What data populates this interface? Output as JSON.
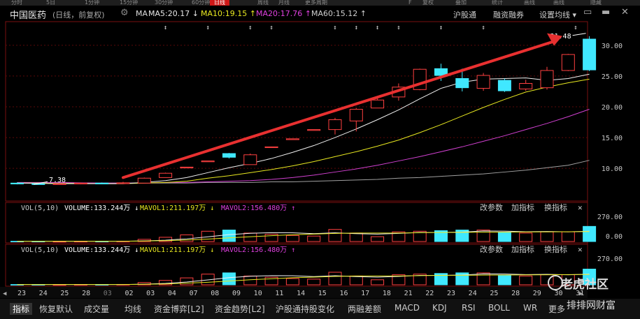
{
  "top_tabs": [
    "分时",
    "5日",
    "1分钟",
    "15分钟",
    "30分钟",
    "60分钟",
    "日线",
    "周线",
    "月线",
    "更多周期",
    "F",
    "复权",
    "叠加",
    "统计",
    "画线",
    "画线",
    "隐藏"
  ],
  "header": {
    "stock_name": "中国医药",
    "mode": "(日线，前复权)",
    "gear_icon": "gear-icon",
    "ma_label": "MA",
    "ma5": "MA5:20.17 ↓",
    "ma10": "MA10:19.15 ↑",
    "ma20": "MA20:17.76 ↑",
    "ma60": "MA60:15.12 ↑",
    "hgt": "沪股通",
    "rzrq": "融资融券",
    "szjx": "设置均线 ▾"
  },
  "chart_data": [
    {
      "type": "candlestick",
      "title": "",
      "ylim": [
        6.5,
        33.5
      ],
      "yticks": [
        "30.00",
        "25.00",
        "20.00",
        "15.00",
        "10.00"
      ],
      "high_label": "31.48",
      "low_label": "7.38",
      "colors": {
        "up": "#ff4040",
        "down": "#40e8ff",
        "ma5": "#f0f0f0",
        "ma10": "#e8e820",
        "ma20": "#d040d0",
        "ma60": "#a0a0a0",
        "arrow": "#e83030"
      },
      "candles": [
        {
          "o": 7.6,
          "c": 7.5,
          "h": 7.7,
          "l": 7.4
        },
        {
          "o": 7.5,
          "c": 7.4,
          "h": 7.6,
          "l": 7.38
        },
        {
          "o": 7.4,
          "c": 7.5,
          "h": 7.6,
          "l": 7.38
        },
        {
          "o": 7.5,
          "c": 7.6,
          "h": 7.7,
          "l": 7.4
        },
        {
          "o": 7.6,
          "c": 7.55,
          "h": 7.7,
          "l": 7.5
        },
        {
          "o": 7.55,
          "c": 7.65,
          "h": 7.8,
          "l": 7.5
        },
        {
          "o": 7.6,
          "c": 8.4,
          "h": 8.5,
          "l": 7.6
        },
        {
          "o": 8.5,
          "c": 9.2,
          "h": 9.3,
          "l": 8.5
        },
        {
          "o": 10.2,
          "c": 10.2,
          "h": 10.2,
          "l": 10.2
        },
        {
          "o": 11.2,
          "c": 11.2,
          "h": 11.2,
          "l": 11.2
        },
        {
          "o": 12.4,
          "c": 11.8,
          "h": 12.5,
          "l": 11.6
        },
        {
          "o": 10.6,
          "c": 12.2,
          "h": 12.4,
          "l": 10.6
        },
        {
          "o": 13.5,
          "c": 13.5,
          "h": 13.5,
          "l": 13.5
        },
        {
          "o": 14.8,
          "c": 14.8,
          "h": 14.8,
          "l": 14.8
        },
        {
          "o": 16.3,
          "c": 16.3,
          "h": 16.3,
          "l": 16.3
        },
        {
          "o": 16.3,
          "c": 17.9,
          "h": 18.2,
          "l": 15.5
        },
        {
          "o": 17.7,
          "c": 19.6,
          "h": 19.8,
          "l": 16.0
        },
        {
          "o": 19.8,
          "c": 21.1,
          "h": 21.4,
          "l": 19.8
        },
        {
          "o": 21.6,
          "c": 23.2,
          "h": 23.8,
          "l": 21.0
        },
        {
          "o": 22.8,
          "c": 26.1,
          "h": 26.2,
          "l": 22.7
        },
        {
          "o": 26.2,
          "c": 25.1,
          "h": 27.0,
          "l": 24.2
        },
        {
          "o": 24.6,
          "c": 23.1,
          "h": 26.2,
          "l": 22.5
        },
        {
          "o": 23.0,
          "c": 25.1,
          "h": 25.5,
          "l": 22.6
        },
        {
          "o": 24.3,
          "c": 22.6,
          "h": 24.6,
          "l": 22.4
        },
        {
          "o": 22.9,
          "c": 23.8,
          "h": 24.4,
          "l": 22.6
        },
        {
          "o": 23.1,
          "c": 25.9,
          "h": 26.5,
          "l": 22.8
        },
        {
          "o": 25.9,
          "c": 28.5,
          "h": 28.6,
          "l": 25.8
        },
        {
          "o": 31.0,
          "c": 26.0,
          "h": 31.48,
          "l": 25.8
        }
      ],
      "ma5": [
        7.6,
        7.55,
        7.5,
        7.5,
        7.5,
        7.5,
        7.7,
        8.0,
        8.5,
        9.3,
        10.1,
        10.8,
        11.6,
        12.6,
        13.7,
        15.0,
        16.4,
        17.9,
        19.5,
        21.3,
        23.0,
        24.0,
        24.5,
        24.6,
        24.7,
        24.3,
        24.6,
        25.3
      ],
      "ma10": [
        7.6,
        7.6,
        7.55,
        7.55,
        7.5,
        7.5,
        7.6,
        7.7,
        7.9,
        8.4,
        8.8,
        9.3,
        9.8,
        10.4,
        11.1,
        11.9,
        12.7,
        13.6,
        14.6,
        15.8,
        17.1,
        18.5,
        19.9,
        21.2,
        22.4,
        23.2,
        23.9,
        24.5
      ],
      "ma20": [
        7.7,
        7.7,
        7.7,
        7.65,
        7.6,
        7.6,
        7.6,
        7.7,
        7.7,
        7.8,
        7.9,
        8.0,
        8.2,
        8.5,
        8.9,
        9.4,
        9.9,
        10.5,
        11.2,
        11.9,
        12.7,
        13.5,
        14.4,
        15.3,
        16.3,
        17.3,
        18.4,
        19.6
      ],
      "ma60": [
        7.6,
        7.6,
        7.6,
        7.6,
        7.6,
        7.6,
        7.6,
        7.6,
        7.6,
        7.7,
        7.7,
        7.7,
        7.8,
        7.8,
        7.9,
        8.0,
        8.1,
        8.2,
        8.4,
        8.5,
        8.7,
        8.9,
        9.1,
        9.4,
        9.7,
        10.1,
        10.5,
        11.3
      ],
      "markers": [
        7,
        9,
        11,
        12,
        15,
        16,
        17,
        18,
        20,
        22
      ]
    },
    {
      "type": "bar",
      "title": "VOL(5,10)",
      "legend": {
        "vol": "VOLUME:133.244万 ↓",
        "ma1": "MAVOL1:211.197万 ↓",
        "ma2": "MAVOL2:156.480万 ↑"
      },
      "ylim": [
        0,
        300
      ],
      "yticks": [
        "270.00",
        "0.00"
      ],
      "values": [
        2,
        2,
        1,
        2,
        2,
        3,
        18,
        35,
        55,
        85,
        95,
        70,
        60,
        50,
        45,
        100,
        70,
        40,
        80,
        85,
        90,
        95,
        95,
        75,
        70,
        80,
        80,
        125
      ],
      "ma1": [
        2,
        2,
        2,
        2,
        2,
        2,
        5,
        11,
        22,
        39,
        57,
        68,
        73,
        72,
        65,
        72,
        65,
        61,
        67,
        75,
        75,
        78,
        87,
        86,
        81,
        83,
        80,
        85
      ],
      "ma2": [
        2,
        2,
        2,
        2,
        2,
        2,
        4,
        7,
        13,
        20,
        30,
        40,
        48,
        56,
        61,
        67,
        70,
        70,
        70,
        73,
        75,
        76,
        77,
        78,
        79,
        80,
        81,
        82
      ]
    },
    {
      "type": "bar",
      "title": "VOL(5,10)",
      "legend": {
        "vol": "VOLUME:133.244万 ↓",
        "ma1": "MAVOL1:211.197万 ↓",
        "ma2": "MAVOL2:156.480万 ↑"
      },
      "ylim": [
        0,
        300
      ],
      "yticks": [
        "270.00"
      ]
    }
  ],
  "vol_panel_tools": [
    "改参数",
    "加指标",
    "换指标",
    "✕"
  ],
  "x_labels": [
    "23",
    "24",
    "25",
    "28",
    "03",
    "02",
    "03",
    "04",
    "07",
    "08",
    "09",
    "10",
    "11",
    "14",
    "15",
    "16",
    "17",
    "18",
    "21",
    "22",
    "23",
    "24",
    "25",
    "28",
    "29",
    "30",
    "31"
  ],
  "bottom_tabs": [
    "指标",
    "恢复默认",
    "成交量",
    "均线",
    "资金博弈[L2]",
    "资金趋势[L2]",
    "沪股通持股变化",
    "两融差额",
    "MACD",
    "KDJ",
    "RSI",
    "BOLL",
    "WR",
    "更多"
  ],
  "watermark": [
    "老虎社区",
    "排排网财富"
  ]
}
